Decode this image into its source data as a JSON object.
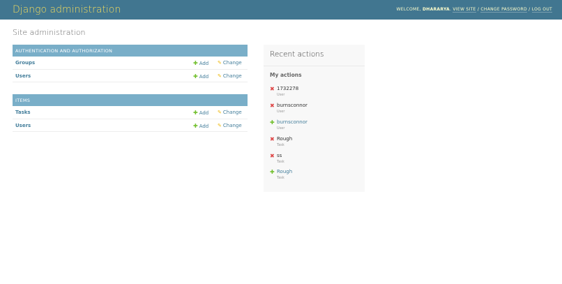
{
  "header": {
    "branding": "Django administration",
    "welcome": "WELCOME, ",
    "username": "DHARARYA",
    "view_site": "VIEW SITE",
    "change_password": "CHANGE PASSWORD",
    "log_out": "LOG OUT",
    "separator": " / "
  },
  "page": {
    "title": "Site administration"
  },
  "modules": [
    {
      "caption": "AUTHENTICATION AND AUTHORIZATION",
      "rows": [
        {
          "name": "Groups",
          "add": "Add",
          "change": "Change"
        },
        {
          "name": "Users",
          "add": "Add",
          "change": "Change"
        }
      ]
    },
    {
      "caption": "ITEMS",
      "rows": [
        {
          "name": "Tasks",
          "add": "Add",
          "change": "Change"
        },
        {
          "name": "Users",
          "add": "Add",
          "change": "Change"
        }
      ]
    }
  ],
  "recent": {
    "title": "Recent actions",
    "subtitle": "My actions",
    "actions": [
      {
        "icon": "delete-icon",
        "object": "1732278",
        "type": "User"
      },
      {
        "icon": "delete-icon",
        "object": "burnsconnor",
        "type": "User"
      },
      {
        "icon": "add-icon",
        "object": "burnsconnor",
        "type": "User"
      },
      {
        "icon": "delete-icon",
        "object": "Rough",
        "type": "Task"
      },
      {
        "icon": "delete-icon",
        "object": "ss",
        "type": "Task"
      },
      {
        "icon": "add-icon",
        "object": "Rough",
        "type": "Task"
      }
    ]
  },
  "colors": {
    "header_bg": "#417690",
    "branding": "#f5dd5d",
    "caption_bg": "#79aec8",
    "link": "#447e9b",
    "add_green": "#70bf2b",
    "change_yellow": "#efb80b",
    "delete_red": "#dd4646"
  }
}
